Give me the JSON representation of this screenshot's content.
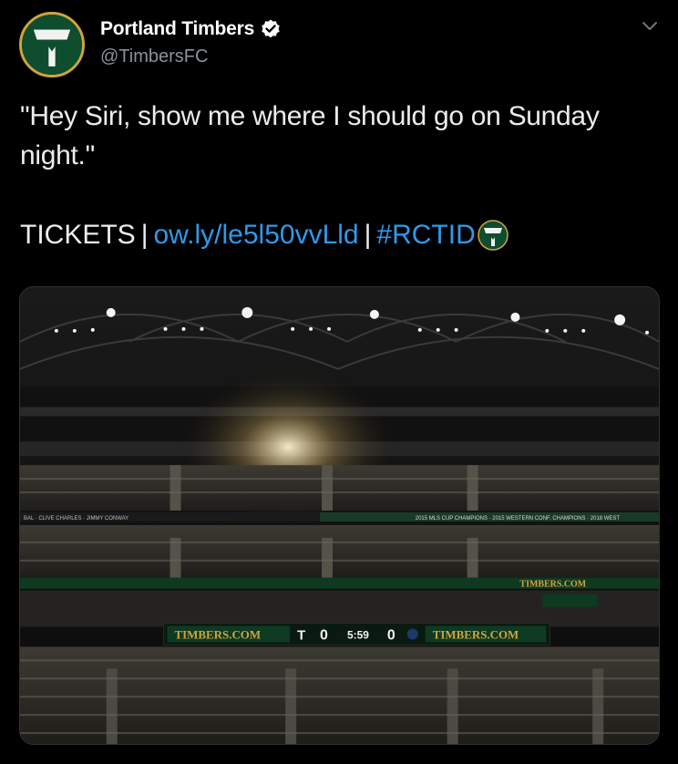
{
  "tweet": {
    "author": {
      "display_name": "Portland Timbers",
      "handle": "@TimbersFC",
      "verified": true,
      "avatar_icon": "timbers-axe-logo"
    },
    "menu_icon": "chevron-down-icon",
    "text_line1": "\"Hey Siri, show me where I should go on Sunday",
    "text_line2": "night.\"",
    "tickets_label": "TICKETS",
    "separator": "|",
    "link_url": "ow.ly/le5l50vvLld",
    "hashtag": "#RCTID",
    "hashtag_emoji": "timbers-axe-logo"
  },
  "media": {
    "scoreboard": {
      "left_ad": "TIMBERS.COM",
      "home_score": "0",
      "clock": "5:59",
      "away_score": "0",
      "right_ad": "TIMBERS.COM"
    },
    "ribbon_right": "TIMBERS.COM",
    "banner_honors": "2015 MLS CUP CHAMPIONS  ·  2015 WESTERN CONF. CHAMPIONS  ·  2018 WEST",
    "banner_left": "BAL · CLIVE CHARLES · JIMMY CONWAY",
    "colors": {
      "link": "#2e9aec",
      "timbers_green": "#0e4d2e",
      "timbers_gold": "#d1a33f",
      "background": "#000000"
    }
  }
}
